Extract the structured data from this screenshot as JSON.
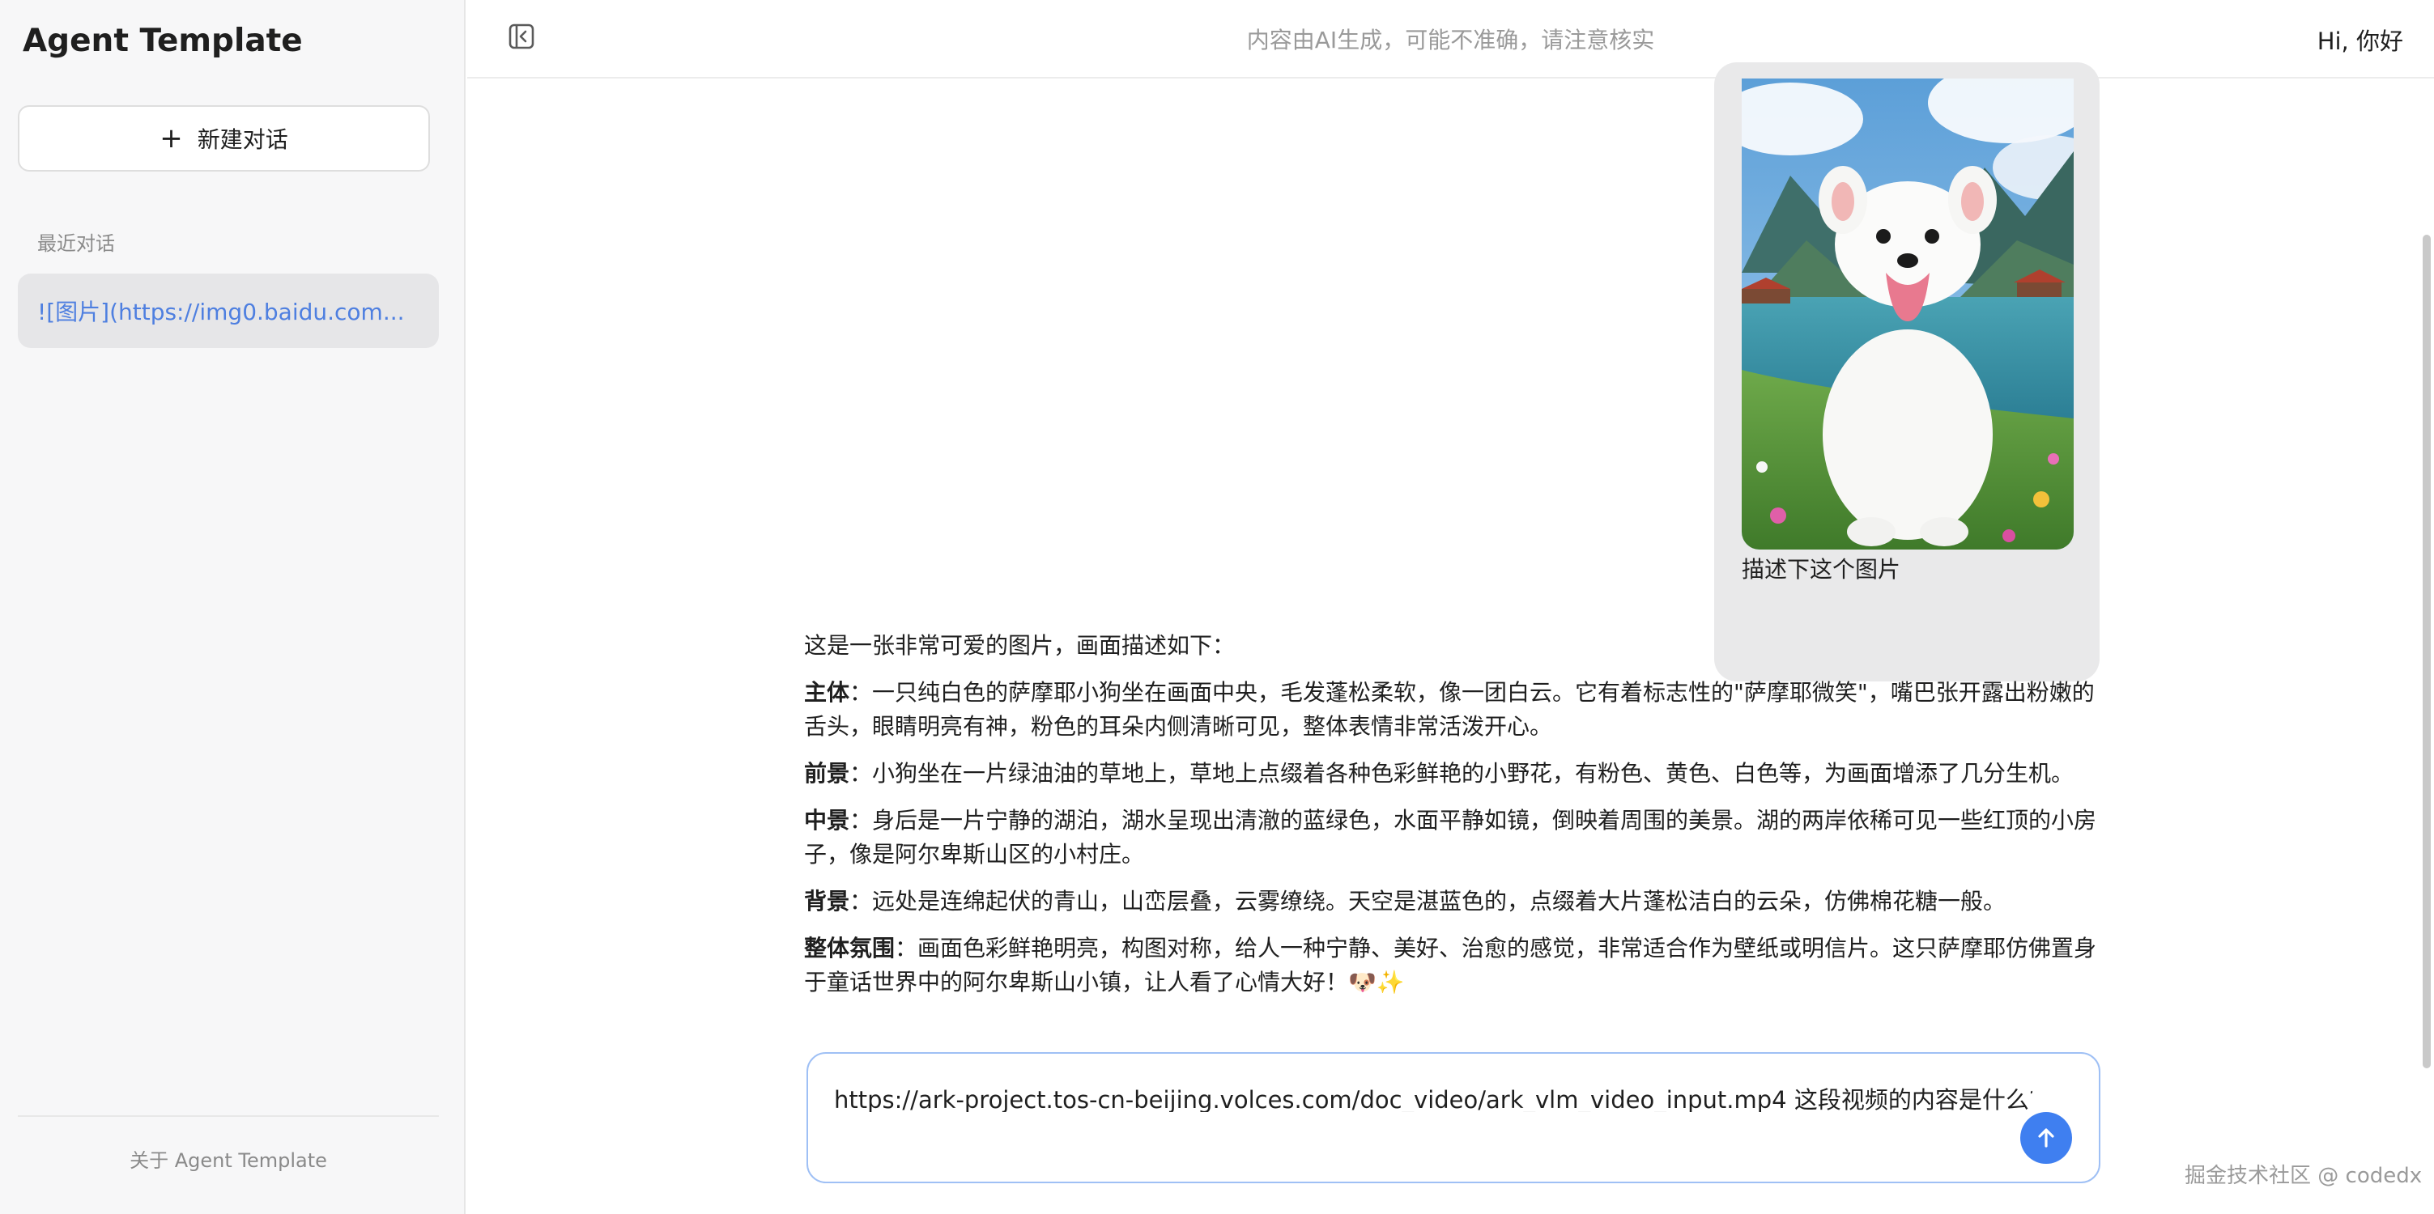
{
  "sidebar": {
    "app_title": "Agent Template",
    "new_chat_label": "新建对话",
    "recent_label": "最近对话",
    "conversations": [
      {
        "title": "![图片](https://img0.baidu.com..."
      }
    ],
    "about_label": "关于 Agent Template"
  },
  "header": {
    "disclaimer": "内容由AI生成，可能不准确，请注意核实",
    "greeting": "Hi, 你好"
  },
  "chat": {
    "user_message": {
      "image_icon": "samoyed-puppy-photo",
      "text": "描述下这个图片"
    },
    "assistant_message": {
      "intro": "这是一张非常可爱的图片，画面描述如下：",
      "sections": [
        {
          "label": "主体",
          "text": "：一只纯白色的萨摩耶小狗坐在画面中央，毛发蓬松柔软，像一团白云。它有着标志性的\"萨摩耶微笑\"，嘴巴张开露出粉嫩的舌头，眼睛明亮有神，粉色的耳朵内侧清晰可见，整体表情非常活泼开心。"
        },
        {
          "label": "前景",
          "text": "：小狗坐在一片绿油油的草地上，草地上点缀着各种色彩鲜艳的小野花，有粉色、黄色、白色等，为画面增添了几分生机。"
        },
        {
          "label": "中景",
          "text": "：身后是一片宁静的湖泊，湖水呈现出清澈的蓝绿色，水面平静如镜，倒映着周围的美景。湖的两岸依稀可见一些红顶的小房子，像是阿尔卑斯山区的小村庄。"
        },
        {
          "label": "背景",
          "text": "：远处是连绵起伏的青山，山峦层叠，云雾缭绕。天空是湛蓝色的，点缀着大片蓬松洁白的云朵，仿佛棉花糖一般。"
        },
        {
          "label": "整体氛围",
          "text": "：画面色彩鲜艳明亮，构图对称，给人一种宁静、美好、治愈的感觉，非常适合作为壁纸或明信片。这只萨摩耶仿佛置身于童话世界中的阿尔卑斯山小镇，让人看了心情大好！🐶✨"
        }
      ]
    }
  },
  "composer": {
    "input_value": "https://ark-project.tos-cn-beijing.volces.com/doc_video/ark_vlm_video_input.mp4 这段视频的内容是什么?",
    "send_icon": "arrow-up-icon"
  },
  "watermark": "掘金技术社区 @ codedx",
  "colors": {
    "accent": "#3f7ff0",
    "link": "#4e7fe0",
    "sidebar_bg": "#f7f7f8",
    "bubble_bg": "#e9e9ea"
  }
}
